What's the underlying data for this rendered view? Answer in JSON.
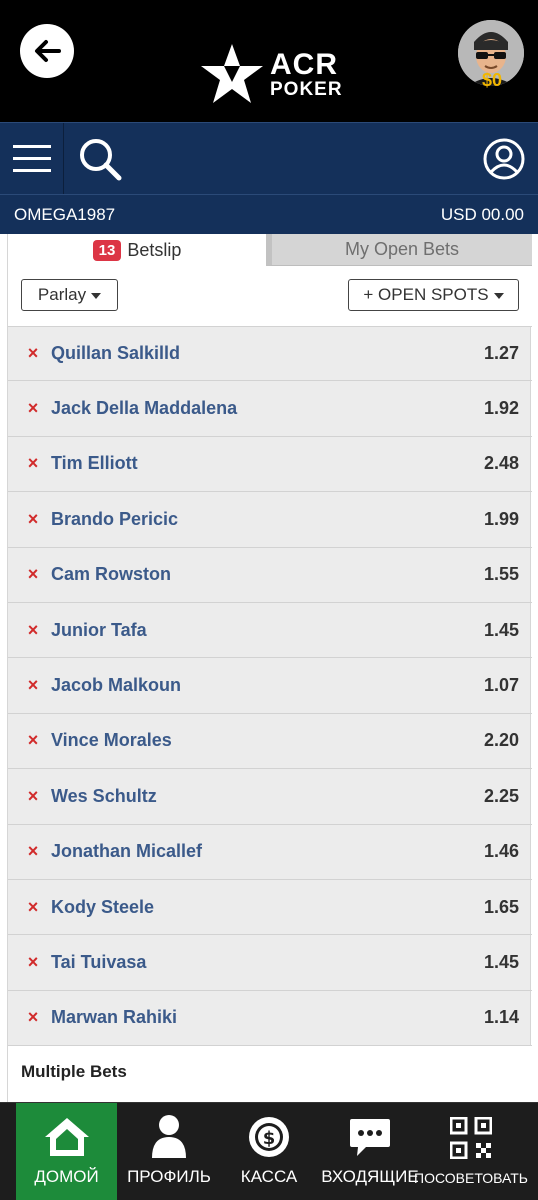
{
  "header": {
    "logo_line1": "ACR",
    "logo_line2": "POKER",
    "avatar_balance": "$0"
  },
  "account": {
    "username": "OMEGA1987",
    "balance": "USD 00.00"
  },
  "tabs": {
    "betslip_count": "13",
    "betslip_label": "Betslip",
    "open_bets_label": "My Open Bets"
  },
  "controls": {
    "bet_type": "Parlay",
    "open_spots": "+ OPEN SPOTS"
  },
  "bets": [
    {
      "name": "Quillan Salkilld",
      "odds": "1.27"
    },
    {
      "name": "Jack Della Maddalena",
      "odds": "1.92"
    },
    {
      "name": "Tim Elliott",
      "odds": "2.48"
    },
    {
      "name": "Brando Pericic",
      "odds": "1.99"
    },
    {
      "name": "Cam Rowston",
      "odds": "1.55"
    },
    {
      "name": "Junior Tafa",
      "odds": "1.45"
    },
    {
      "name": "Jacob Malkoun",
      "odds": "1.07"
    },
    {
      "name": "Vince Morales",
      "odds": "2.20"
    },
    {
      "name": "Wes Schultz",
      "odds": "2.25"
    },
    {
      "name": "Jonathan Micallef",
      "odds": "1.46"
    },
    {
      "name": "Kody Steele",
      "odds": "1.65"
    },
    {
      "name": "Tai Tuivasa",
      "odds": "1.45"
    },
    {
      "name": "Marwan Rahiki",
      "odds": "1.14"
    }
  ],
  "remove_glyph": "×",
  "multiple_bets_label": "Multiple Bets",
  "bottom_nav": {
    "home": "ДОМОЙ",
    "profile": "ПРОФИЛЬ",
    "cashier": "КАССА",
    "inbox": "ВХОДЯЩИЕ",
    "refer": "ПОСОВЕТОВАТЬ"
  },
  "icons": {
    "back": "arrow-left-icon",
    "menu": "hamburger-icon",
    "search": "search-icon",
    "account": "user-circle-icon",
    "home": "home-icon",
    "profile": "person-icon",
    "cashier": "dollar-coin-icon",
    "inbox": "chat-bubble-icon",
    "refer": "qr-code-icon"
  },
  "colors": {
    "topbar": "#000000",
    "navbar": "#14305a",
    "badge": "#dc3545",
    "bet_name": "#3b5a8a",
    "remove": "#d12b2b",
    "active_nav": "#1d8b3a",
    "bottom_bar": "#1d1d1d"
  }
}
